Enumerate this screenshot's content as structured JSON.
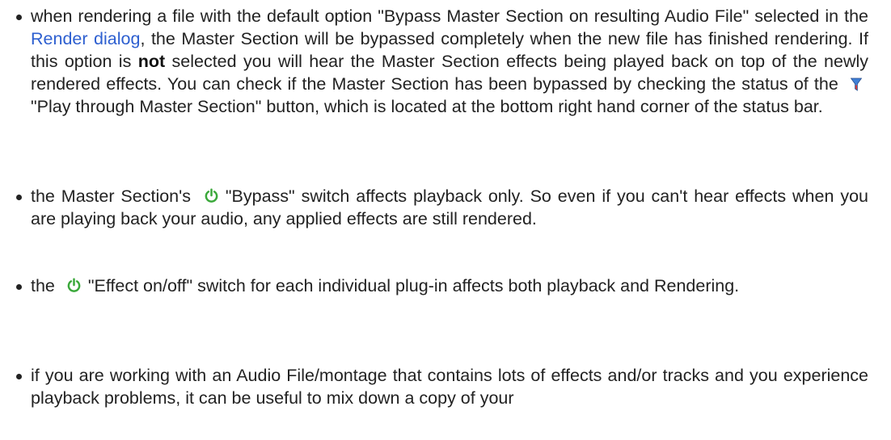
{
  "colors": {
    "text": "#222222",
    "link": "#2d5fd0",
    "power_icon": "#3aa83a",
    "funnel_top": "#3f7fd6",
    "funnel_bottom": "#d23d3d"
  },
  "bullets": [
    {
      "part1": "when rendering a file with the default option \"Bypass Master Section on resulting Audio File\" selected in the ",
      "link": "Render dialog",
      "part2": ", the Master Section will be bypassed completely when the new file has finished rendering. If this option is ",
      "bold": "not",
      "part3": " selected you will hear the Master Section effects being played back on top of the newly rendered effects.  You can check if the Master Section has been bypassed by checking the status of the ",
      "icon": "funnel-icon",
      "part4": "\"Play through Master Section\" button, which is located at the bottom right hand corner of the status bar."
    },
    {
      "part1": "the Master Section's ",
      "icon": "power-icon",
      "part2": "\"Bypass\" switch affects playback only.  So even if you can't hear effects when you are playing back your audio, any applied effects are still rendered."
    },
    {
      "part1": "the ",
      "icon": "power-icon",
      "part2": "\"Effect on/off\" switch for each individual plug-in affects both playback and Rendering."
    },
    {
      "part1": "if you are working with an Audio File/montage that contains lots of effects and/or tracks and you experience playback problems, it can be useful to mix down a copy of your"
    }
  ]
}
